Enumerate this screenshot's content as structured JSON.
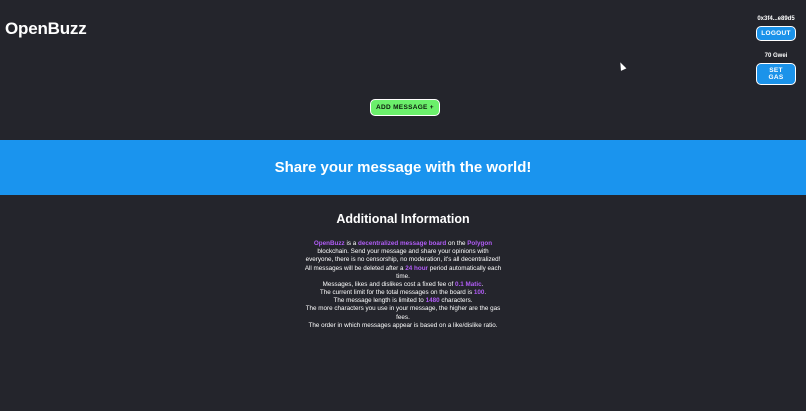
{
  "header": {
    "logo": "OpenBuzz",
    "wallet_address": "0x3f4...e89d5",
    "logout_label": "LOGOUT",
    "gas_value": "70 Gwei",
    "set_gas_label": "SET GAS"
  },
  "actions": {
    "add_message_label": "ADD MESSAGE +"
  },
  "hero": {
    "text": "Share your message with the world!"
  },
  "info": {
    "title": "Additional Information",
    "p1": {
      "a": "OpenBuzz",
      "b": " is a ",
      "c": "decentralized message board",
      "d": " on the ",
      "e": "Polygon",
      "f": " blockchain. Send your message and share your opinions with everyone, there is no censorship, no moderation, it's all decentralized!"
    },
    "p2": {
      "a": "All messages will be deleted after a ",
      "b": "24 hour",
      "c": " period automatically each time."
    },
    "p3": {
      "a": "Messages, likes and dislikes cost a fixed fee of ",
      "b": "0.1 Matic",
      "c": "."
    },
    "p4": {
      "a": "The current limit for the total messages on the board is ",
      "b": "100",
      "c": "."
    },
    "p5": {
      "a": "The message length is limited to ",
      "b": "1480",
      "c": " characters."
    },
    "p6": "The more characters you use in your message, the higher are the gas fees.",
    "p7": "The order in which messages appear is based on a like/dislike ratio."
  },
  "colors": {
    "background": "#24252c",
    "accent_blue": "#1a94ee",
    "accent_green": "#6bf06b",
    "highlight_purple": "#b05cf5"
  }
}
